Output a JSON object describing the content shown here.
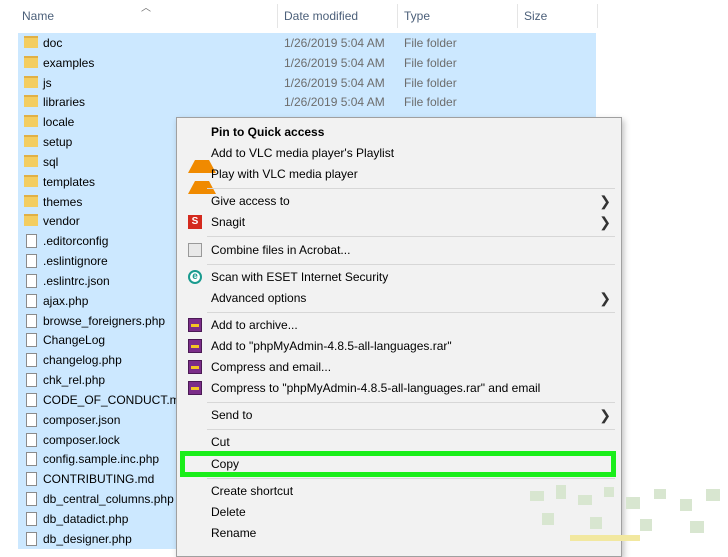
{
  "columns": {
    "name": "Name",
    "date": "Date modified",
    "type": "Type",
    "size": "Size"
  },
  "files": [
    {
      "name": "doc",
      "date": "1/26/2019 5:04 AM",
      "type": "File folder",
      "kind": "folder"
    },
    {
      "name": "examples",
      "date": "1/26/2019 5:04 AM",
      "type": "File folder",
      "kind": "folder"
    },
    {
      "name": "js",
      "date": "1/26/2019 5:04 AM",
      "type": "File folder",
      "kind": "folder"
    },
    {
      "name": "libraries",
      "date": "1/26/2019 5:04 AM",
      "type": "File folder",
      "kind": "folder"
    },
    {
      "name": "locale",
      "date": "",
      "type": "",
      "kind": "folder"
    },
    {
      "name": "setup",
      "date": "",
      "type": "",
      "kind": "folder"
    },
    {
      "name": "sql",
      "date": "",
      "type": "",
      "kind": "folder"
    },
    {
      "name": "templates",
      "date": "",
      "type": "",
      "kind": "folder"
    },
    {
      "name": "themes",
      "date": "",
      "type": "",
      "kind": "folder"
    },
    {
      "name": "vendor",
      "date": "",
      "type": "",
      "kind": "folder"
    },
    {
      "name": ".editorconfig",
      "date": "",
      "type": "",
      "kind": "file"
    },
    {
      "name": ".eslintignore",
      "date": "",
      "type": "",
      "kind": "file"
    },
    {
      "name": ".eslintrc.json",
      "date": "",
      "type": "",
      "kind": "file"
    },
    {
      "name": "ajax.php",
      "date": "",
      "type": "",
      "kind": "file"
    },
    {
      "name": "browse_foreigners.php",
      "date": "",
      "type": "",
      "kind": "file"
    },
    {
      "name": "ChangeLog",
      "date": "",
      "type": "",
      "kind": "file"
    },
    {
      "name": "changelog.php",
      "date": "",
      "type": "",
      "kind": "file"
    },
    {
      "name": "chk_rel.php",
      "date": "",
      "type": "",
      "kind": "file"
    },
    {
      "name": "CODE_OF_CONDUCT.md",
      "date": "",
      "type": "",
      "kind": "file"
    },
    {
      "name": "composer.json",
      "date": "",
      "type": "",
      "kind": "file"
    },
    {
      "name": "composer.lock",
      "date": "",
      "type": "",
      "kind": "file"
    },
    {
      "name": "config.sample.inc.php",
      "date": "",
      "type": "",
      "kind": "file"
    },
    {
      "name": "CONTRIBUTING.md",
      "date": "",
      "type": "",
      "kind": "file"
    },
    {
      "name": "db_central_columns.php",
      "date": "",
      "type": "",
      "kind": "file"
    },
    {
      "name": "db_datadict.php",
      "date": "",
      "type": "",
      "kind": "file"
    },
    {
      "name": "db_designer.php",
      "date": "",
      "type": "",
      "kind": "file"
    }
  ],
  "menu": {
    "pin": "Pin to Quick access",
    "vlc_playlist": "Add to VLC media player's Playlist",
    "vlc_play": "Play with VLC media player",
    "give_access": "Give access to",
    "snagit": "Snagit",
    "acrobat": "Combine files in Acrobat...",
    "eset": "Scan with ESET Internet Security",
    "advanced": "Advanced options",
    "add_archive": "Add to archive...",
    "add_rar": "Add to \"phpMyAdmin-4.8.5-all-languages.rar\"",
    "compress_email": "Compress and email...",
    "compress_rar_email": "Compress to \"phpMyAdmin-4.8.5-all-languages.rar\" and email",
    "send_to": "Send to",
    "cut": "Cut",
    "copy": "Copy",
    "create_shortcut": "Create shortcut",
    "delete": "Delete",
    "rename": "Rename"
  },
  "icons": {
    "folder": "folder-icon",
    "file": "file-icon",
    "vlc": "vlc-cone-icon",
    "snagit": "snagit-icon",
    "acrobat": "acrobat-icon",
    "eset": "eset-icon",
    "winrar": "winrar-icon",
    "submenu": "chevron-right-icon",
    "sort": "sort-up-icon"
  },
  "colors": {
    "selection": "#cce8ff",
    "highlight": "#1aee1a",
    "menu_bg": "#f2f2f2"
  }
}
